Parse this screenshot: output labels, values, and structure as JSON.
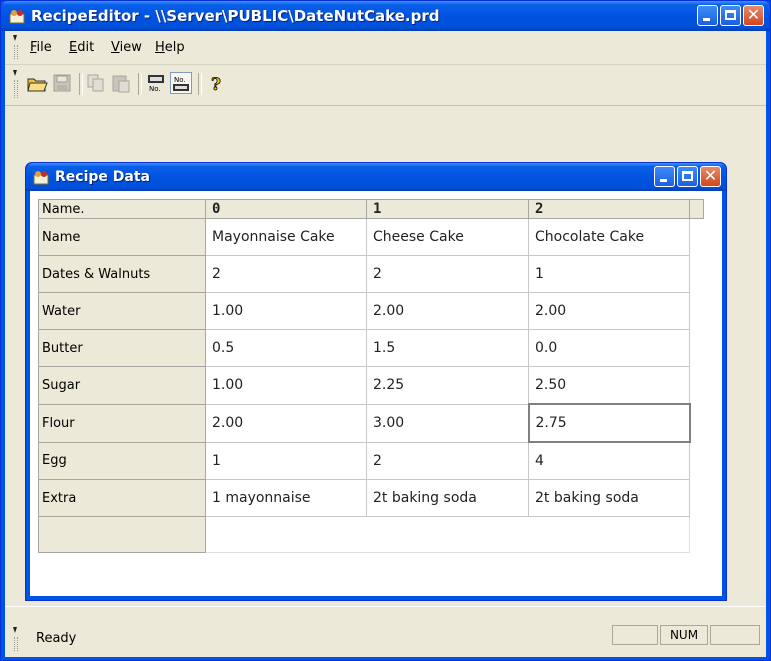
{
  "window": {
    "title": "RecipeEditor - \\\\Server\\PUBLIC\\DateNutCake.prd"
  },
  "menu": {
    "items": [
      {
        "label": "File",
        "mnemonic": "F",
        "rest": "ile"
      },
      {
        "label": "Edit",
        "mnemonic": "E",
        "rest": "dit"
      },
      {
        "label": "View",
        "mnemonic": "V",
        "rest": "iew"
      },
      {
        "label": "Help",
        "mnemonic": "H",
        "rest": "elp"
      }
    ]
  },
  "toolbar": {
    "buttons": [
      {
        "name": "open-folder-icon",
        "enabled": true
      },
      {
        "name": "save-disk-icon",
        "enabled": false
      },
      {
        "name": "copy-icon",
        "enabled": false
      },
      {
        "name": "paste-icon",
        "enabled": false
      },
      {
        "name": "record-number-icon",
        "enabled": true,
        "pressed": false
      },
      {
        "name": "record-number-alt-icon",
        "enabled": true,
        "pressed": true
      },
      {
        "name": "help-question-icon",
        "enabled": true
      }
    ],
    "icon_text": {
      "record_no": "No."
    }
  },
  "child_window": {
    "title": "Recipe Data"
  },
  "grid": {
    "row_headers": [
      "Name.",
      "Name",
      "Dates & Walnuts",
      "Water",
      "Butter",
      "Sugar",
      "Flour",
      "Egg",
      "Extra"
    ],
    "columns": [
      "0",
      "1",
      "2"
    ],
    "rows": [
      [
        "Mayonnaise Cake",
        "Cheese Cake",
        "Chocolate Cake"
      ],
      [
        "2",
        "2",
        "1"
      ],
      [
        "1.00",
        "2.00",
        "2.00"
      ],
      [
        "0.5",
        "1.5",
        "0.0"
      ],
      [
        "1.00",
        "2.25",
        "2.50"
      ],
      [
        "2.00",
        "3.00",
        "2.75"
      ],
      [
        "1",
        "2",
        "4"
      ],
      [
        "1 mayonnaise",
        "2t baking soda",
        "2t baking soda"
      ]
    ],
    "selected_cell": {
      "row": 5,
      "col": 2
    }
  },
  "status": {
    "text": "Ready",
    "panes": [
      "",
      "NUM",
      ""
    ]
  },
  "colors": {
    "xp_blue": "#0054E3",
    "face": "#ECE9D8",
    "close_red": "#D2461E"
  }
}
